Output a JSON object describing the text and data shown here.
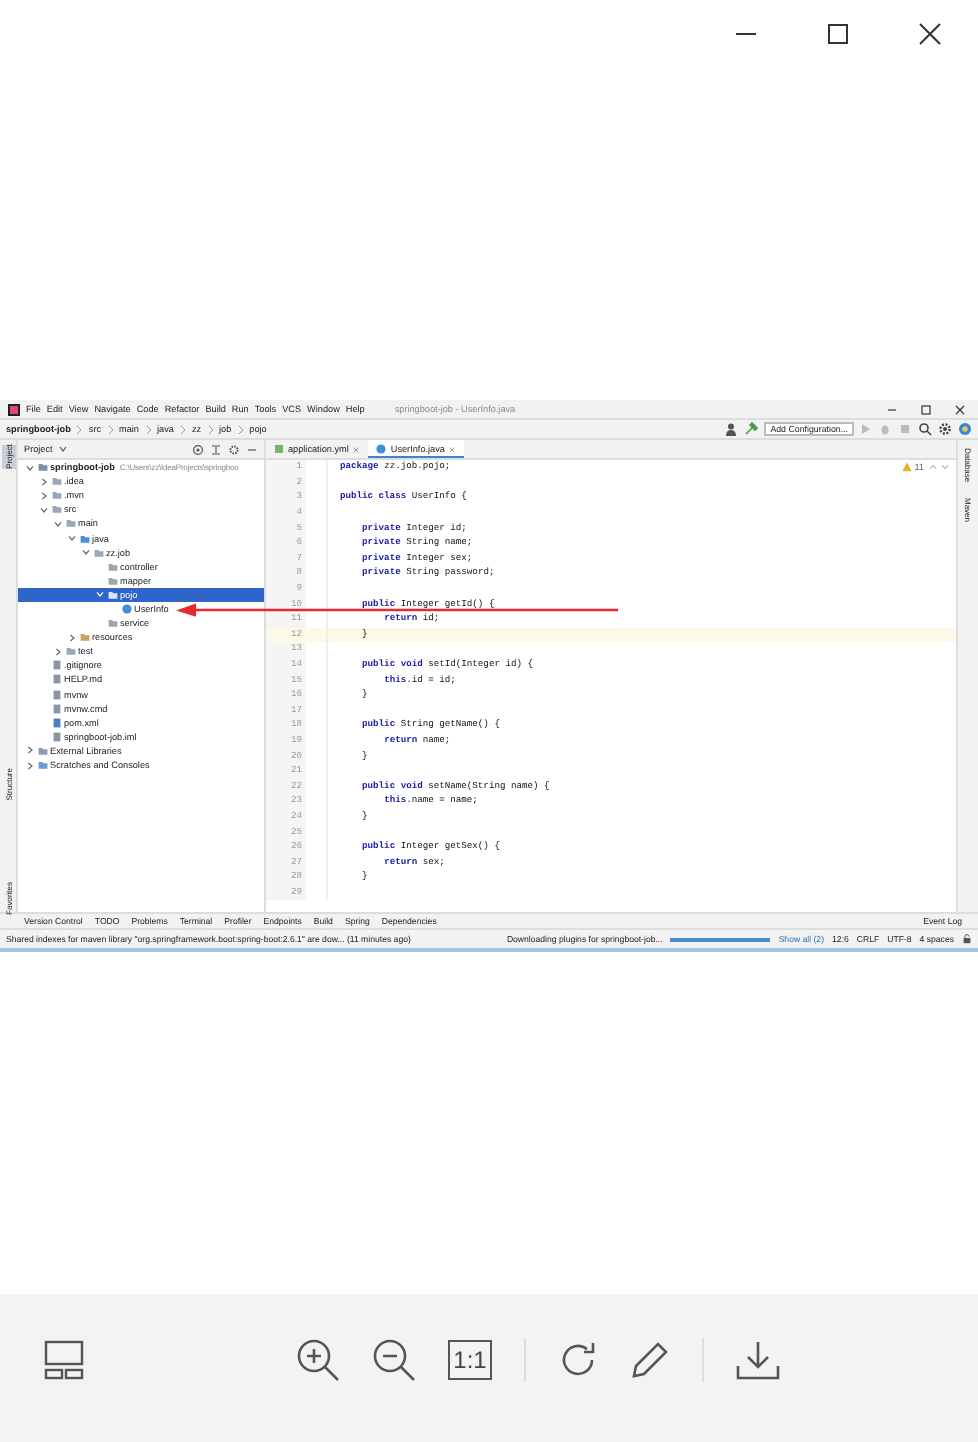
{
  "viewer": {
    "toolbar": {
      "actual_size": "1:1"
    }
  },
  "ide": {
    "title": "springboot-job - UserInfo.java",
    "menu": [
      "File",
      "Edit",
      "View",
      "Navigate",
      "Code",
      "Refactor",
      "Build",
      "Run",
      "Tools",
      "VCS",
      "Window",
      "Help"
    ],
    "breadcrumbs": [
      "springboot-job",
      "src",
      "main",
      "java",
      "zz",
      "job",
      "pojo"
    ],
    "run_config": "Add Configuration...",
    "left_stripe": [
      {
        "label": "Project",
        "selected": true
      },
      {
        "label": "Structure",
        "selected": false
      },
      {
        "label": "Favorites",
        "selected": false
      }
    ],
    "right_stripe": [
      {
        "label": "Database",
        "selected": false
      },
      {
        "label": "Maven",
        "selected": false
      }
    ],
    "project": {
      "title": "Project",
      "tree": [
        {
          "label": "springboot-job",
          "path": "C:\\Users\\zz\\IdeaProjects\\springboo",
          "kind": "module",
          "expanded": true,
          "selected": false,
          "children": [
            {
              "label": ".idea",
              "kind": "folder",
              "expanded": false,
              "selected": false
            },
            {
              "label": ".mvn",
              "kind": "folder",
              "expanded": false,
              "selected": false
            },
            {
              "label": "src",
              "kind": "folder",
              "expanded": true,
              "selected": false,
              "children": [
                {
                  "label": "main",
                  "kind": "folder",
                  "expanded": true,
                  "selected": false,
                  "children": [
                    {
                      "label": "java",
                      "kind": "source",
                      "expanded": true,
                      "selected": false,
                      "children": [
                        {
                          "label": "zz.job",
                          "kind": "package",
                          "expanded": true,
                          "selected": false,
                          "children": [
                            {
                              "label": "controller",
                              "kind": "package",
                              "selected": false
                            },
                            {
                              "label": "mapper",
                              "kind": "package",
                              "selected": false
                            },
                            {
                              "label": "pojo",
                              "kind": "package",
                              "expanded": true,
                              "selected": true,
                              "children": [
                                {
                                  "label": "UserInfo",
                                  "kind": "class",
                                  "selected": false
                                }
                              ]
                            },
                            {
                              "label": "service",
                              "kind": "package",
                              "selected": false
                            }
                          ]
                        }
                      ]
                    },
                    {
                      "label": "resources",
                      "kind": "resources",
                      "expanded": false,
                      "selected": false
                    }
                  ]
                },
                {
                  "label": "test",
                  "kind": "folder",
                  "expanded": false,
                  "selected": false
                }
              ]
            },
            {
              "label": ".gitignore",
              "kind": "file",
              "selected": false
            },
            {
              "label": "HELP.md",
              "kind": "file",
              "selected": false
            },
            {
              "label": "mvnw",
              "kind": "file",
              "selected": false
            },
            {
              "label": "mvnw.cmd",
              "kind": "file",
              "selected": false
            },
            {
              "label": "pom.xml",
              "kind": "xml",
              "selected": false
            },
            {
              "label": "springboot-job.iml",
              "kind": "file",
              "selected": false
            }
          ]
        },
        {
          "label": "External Libraries",
          "kind": "library",
          "expanded": false,
          "selected": false
        },
        {
          "label": "Scratches and Consoles",
          "kind": "scratch",
          "expanded": false,
          "selected": false
        }
      ]
    },
    "tabs": [
      {
        "label": "application.yml",
        "kind": "yaml",
        "selected": false
      },
      {
        "label": "UserInfo.java",
        "kind": "class",
        "selected": true
      }
    ],
    "warnings": "11",
    "code": [
      {
        "number": "1",
        "text": "**package** zz.job.pojo;",
        "current": false
      },
      {
        "number": "2",
        "current": false
      },
      {
        "number": "3",
        "text": "**public class** UserInfo {",
        "current": false
      },
      {
        "number": "4",
        "current": false
      },
      {
        "number": "5",
        "text": "    **private** Integer id;",
        "current": false
      },
      {
        "number": "6",
        "text": "    **private** String name;",
        "current": false
      },
      {
        "number": "7",
        "text": "    **private** Integer sex;",
        "current": false
      },
      {
        "number": "8",
        "text": "    **private** String password;",
        "current": false
      },
      {
        "number": "9",
        "current": false
      },
      {
        "number": "10",
        "text": "    **public** Integer getId() {",
        "current": false
      },
      {
        "number": "11",
        "text": "        **return** id;",
        "current": false
      },
      {
        "number": "12",
        "text": "    }",
        "current": true
      },
      {
        "number": "13",
        "current": false
      },
      {
        "number": "14",
        "text": "    **public void** setId(Integer id) {",
        "current": false
      },
      {
        "number": "15",
        "text": "        **this**.id = id;",
        "current": false
      },
      {
        "number": "16",
        "text": "    }",
        "current": false
      },
      {
        "number": "17",
        "current": false
      },
      {
        "number": "18",
        "text": "    **public** String getName() {",
        "current": false
      },
      {
        "number": "19",
        "text": "        **return** name;",
        "current": false
      },
      {
        "number": "20",
        "text": "    }",
        "current": false
      },
      {
        "number": "21",
        "current": false
      },
      {
        "number": "22",
        "text": "    **public void** setName(String name) {",
        "current": false
      },
      {
        "number": "23",
        "text": "        **this**.name = name;",
        "current": false
      },
      {
        "number": "24",
        "text": "    }",
        "current": false
      },
      {
        "number": "25",
        "current": false
      },
      {
        "number": "26",
        "text": "    **public** Integer getSex() {",
        "current": false
      },
      {
        "number": "27",
        "text": "        **return** sex;",
        "current": false
      },
      {
        "number": "28",
        "text": "    }",
        "current": false
      },
      {
        "number": "29",
        "current": false
      }
    ],
    "tool_windows": [
      "Version Control",
      "TODO",
      "Problems",
      "Terminal",
      "Profiler",
      "Endpoints",
      "Build",
      "Spring",
      "Dependencies"
    ],
    "event_log": "Event Log",
    "status": {
      "message": "Shared indexes for maven library \"org.springframework.boot:spring-boot:2.6.1\" are dow... (11 minutes ago)",
      "task": "Downloading plugins for springboot-job...",
      "level": 1.0,
      "show_all": "Show all (2)",
      "position": "12:6",
      "line_sep": "CRLF",
      "encoding": "UTF-8",
      "indent": "4 spaces"
    }
  }
}
